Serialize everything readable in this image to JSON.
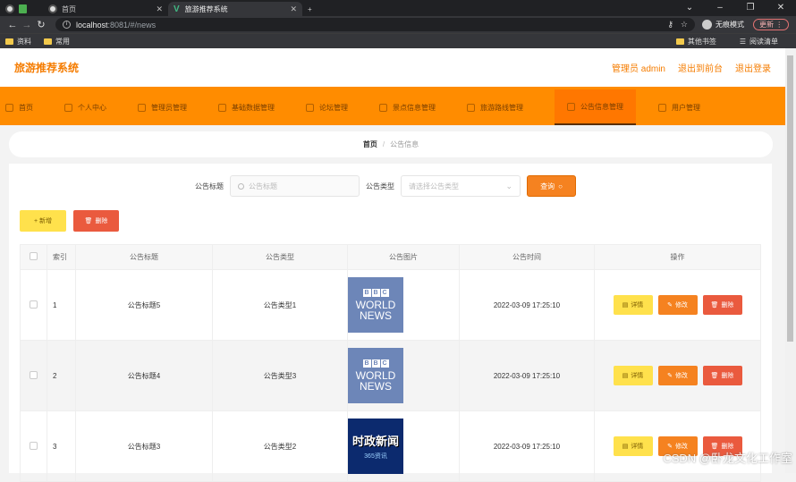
{
  "browser": {
    "tabs": [
      {
        "label": ""
      },
      {
        "label": "首页"
      },
      {
        "label": "旅游推荐系统"
      }
    ],
    "url_host": "localhost",
    "url_path": ":8081/#/news",
    "profile_label": "无痕模式",
    "update_label": "更新",
    "bookmarks": [
      "资料",
      "常用"
    ],
    "bookmarks_right": [
      "其他书签",
      "阅读清单"
    ]
  },
  "header": {
    "logo": "旅游推荐系统",
    "user": "管理员 admin",
    "back_front": "退出到前台",
    "logout": "退出登录"
  },
  "menu": [
    {
      "label": "首页",
      "icon": "home-icon"
    },
    {
      "label": "个人中心",
      "icon": "user-icon"
    },
    {
      "label": "管理员管理",
      "icon": "admin-icon"
    },
    {
      "label": "基础数据管理",
      "icon": "data-icon"
    },
    {
      "label": "论坛管理",
      "icon": "forum-icon"
    },
    {
      "label": "景点信息管理",
      "icon": "chart-icon"
    },
    {
      "label": "旅游路线管理",
      "icon": "route-icon"
    },
    {
      "label": "公告信息管理",
      "icon": "notice-icon",
      "active": true
    },
    {
      "label": "用户管理",
      "icon": "users-icon"
    }
  ],
  "breadcrumb": {
    "home": "首页",
    "sep": "/",
    "current": "公告信息"
  },
  "search": {
    "title_label": "公告标题",
    "title_placeholder": "公告标题",
    "type_label": "公告类型",
    "type_placeholder": "请选择公告类型",
    "query_label": "查询"
  },
  "actions": {
    "add": "+ 新增",
    "delete": "删除"
  },
  "table": {
    "headers": [
      "",
      "索引",
      "公告标题",
      "公告类型",
      "公告图片",
      "公告时间",
      "操作"
    ],
    "rows": [
      {
        "index": "1",
        "title": "公告标题5",
        "type": "公告类型1",
        "image": "bbc",
        "time": "2022-03-09 17:25:10"
      },
      {
        "index": "2",
        "title": "公告标题4",
        "type": "公告类型3",
        "image": "bbc",
        "time": "2022-03-09 17:25:10"
      },
      {
        "index": "3",
        "title": "公告标题3",
        "type": "公告类型2",
        "image": "news",
        "time": "2022-03-09 17:25:10"
      }
    ],
    "row_buttons": {
      "detail": "详情",
      "edit": "修改",
      "remove": "删除"
    },
    "bbc_logo": [
      "B",
      "B",
      "C"
    ],
    "bbc_text1": "WORLD",
    "bbc_text2": "NEWS",
    "news_text1": "时政新闻",
    "news_text2": "365资讯"
  },
  "watermark": "CSDN @卧龙文化工作室",
  "colors": {
    "accent": "#ff8c00",
    "brand_text": "#f57c00",
    "danger": "#ea5a3e",
    "warn": "#ffe14c"
  }
}
